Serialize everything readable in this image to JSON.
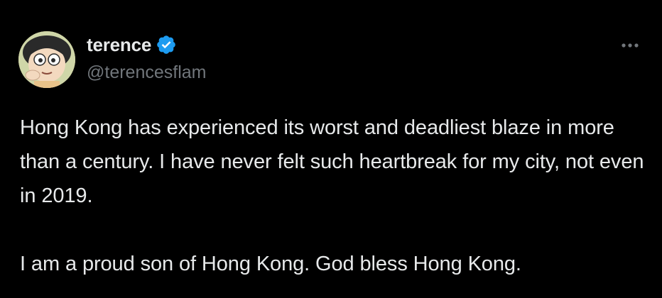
{
  "theme": {
    "background": "#000000",
    "text": "#e7e9ea",
    "muted": "#71767b",
    "verified_blue": "#1d9bf0"
  },
  "author": {
    "display_name": "terence",
    "handle": "@terencesflam",
    "verified_icon": "verified-badge-icon",
    "avatar": "cartoon-avatar"
  },
  "menu": {
    "icon": "more-horizontal-icon"
  },
  "tweet": {
    "paragraphs": [
      "Hong Kong has experienced its worst and deadliest blaze in more than a century. I have never felt such heartbreak for my city, not even in 2019.",
      "I am a proud son of Hong Kong. God bless Hong Kong."
    ]
  }
}
